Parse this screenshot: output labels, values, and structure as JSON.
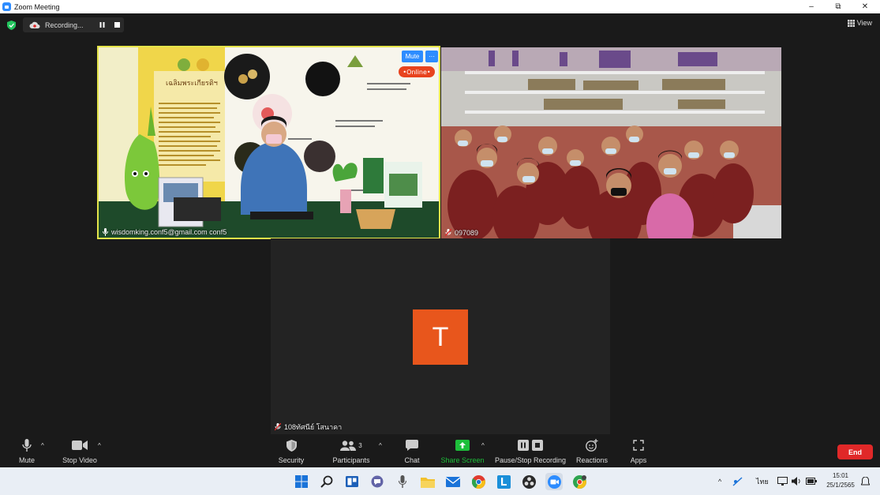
{
  "window": {
    "title": "Zoom Meeting",
    "minimize": "–",
    "restore": "⧉",
    "close": "✕"
  },
  "recording": {
    "label": "Recording..."
  },
  "view_button": {
    "label": "View"
  },
  "participants": [
    {
      "name": "wisdomking.conf5@gmail.com conf5",
      "muted": false
    },
    {
      "name": "097089",
      "muted": true
    },
    {
      "name": "108ทัศนีย์ โสนาคา",
      "muted": true,
      "avatar_letter": "T"
    }
  ],
  "tile_controls": {
    "mute_label": "Mute",
    "more_label": "···"
  },
  "video_overlay": {
    "badge": "•Online•",
    "poster_heading": "เฉลิมพระเกียรติฯ"
  },
  "toolbar": {
    "mute": "Mute",
    "stop_video": "Stop Video",
    "security": "Security",
    "participants": "Participants",
    "participants_count": "3",
    "chat": "Chat",
    "share_screen": "Share Screen",
    "pause_stop_recording": "Pause/Stop Recording",
    "reactions": "Reactions",
    "apps": "Apps",
    "end": "End"
  },
  "taskbar": {
    "language": "ไทย",
    "time": "15:01",
    "date": "25/1/2565"
  },
  "colors": {
    "accent": "#2d8cff",
    "share_green": "#1dbf3a",
    "end_red": "#e02828",
    "avatar_orange": "#e8561c",
    "active_speaker_border": "#e4e44a"
  }
}
